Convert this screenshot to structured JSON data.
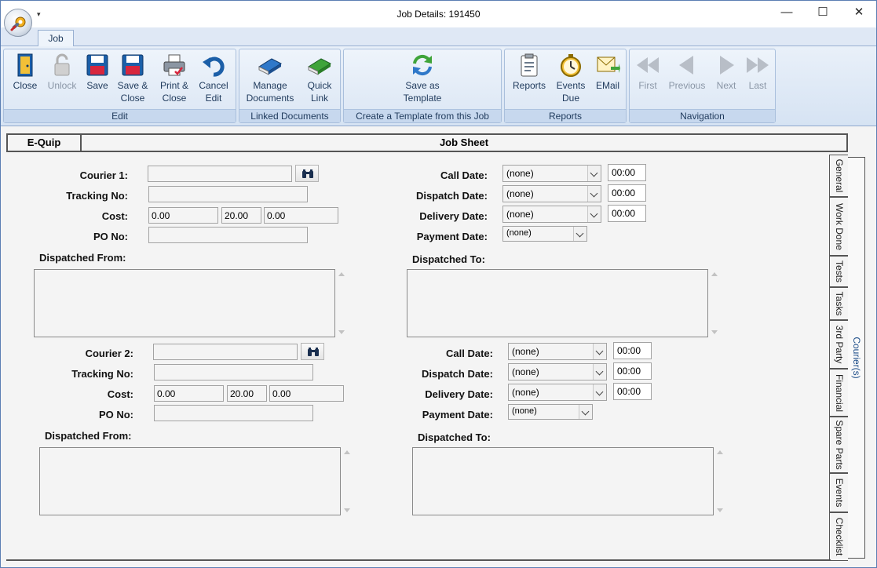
{
  "window": {
    "title": "Job Details: 191450",
    "qat_glyph": "▾",
    "controls": {
      "minimize": "—",
      "maximize": "☐",
      "close": "✕"
    }
  },
  "ribbon": {
    "tab": "Job",
    "groups": {
      "edit": {
        "label": "Edit",
        "buttons": {
          "close": [
            "Close"
          ],
          "unlock": [
            "Unlock"
          ],
          "save": [
            "Save"
          ],
          "save_close": [
            "Save &",
            "Close"
          ],
          "print_close": [
            "Print &",
            "Close"
          ],
          "cancel_edit": [
            "Cancel",
            "Edit"
          ]
        }
      },
      "linked": {
        "label": "Linked Documents",
        "buttons": {
          "manage": [
            "Manage",
            "Documents"
          ],
          "quick_link": [
            "Quick",
            "Link"
          ]
        }
      },
      "template": {
        "label": "Create a Template from this Job",
        "buttons": {
          "save_template": [
            "Save as",
            "Template"
          ]
        }
      },
      "reports": {
        "label": "Reports",
        "buttons": {
          "reports": [
            "Reports"
          ],
          "events_due": [
            "Events",
            "Due"
          ],
          "email": [
            "EMail"
          ]
        }
      },
      "navigation": {
        "label": "Navigation",
        "buttons": {
          "first": [
            "First"
          ],
          "previous": [
            "Previous"
          ],
          "next": [
            "Next"
          ],
          "last": [
            "Last"
          ]
        }
      }
    }
  },
  "header": {
    "left": "E-Quip",
    "title": "Job Sheet"
  },
  "courier1": {
    "labels": {
      "courier": "Courier 1:",
      "tracking": "Tracking No:",
      "cost": "Cost:",
      "po": "PO No:",
      "from": "Dispatched From:",
      "to": "Dispatched To:",
      "call": "Call Date:",
      "dispatch": "Dispatch Date:",
      "delivery": "Delivery Date:",
      "payment": "Payment Date:"
    },
    "courier": "",
    "tracking": "",
    "cost": [
      "0.00",
      "20.00",
      "0.00"
    ],
    "po": "",
    "call_date": "(none)",
    "call_time": "00:00",
    "dispatch_date": "(none)",
    "dispatch_time": "00:00",
    "delivery_date": "(none)",
    "delivery_time": "00:00",
    "payment_date": "(none)"
  },
  "courier2": {
    "labels": {
      "courier": "Courier 2:",
      "tracking": "Tracking No:",
      "cost": "Cost:",
      "po": "PO No:",
      "from": "Dispatched From:",
      "to": "Dispatched To:",
      "call": "Call Date:",
      "dispatch": "Dispatch Date:",
      "delivery": "Delivery Date:",
      "payment": "Payment Date:"
    },
    "courier": "",
    "tracking": "",
    "cost": [
      "0.00",
      "20.00",
      "0.00"
    ],
    "po": "",
    "call_date": "(none)",
    "call_time": "00:00",
    "dispatch_date": "(none)",
    "dispatch_time": "00:00",
    "delivery_date": "(none)",
    "delivery_time": "00:00",
    "payment_date": "(none)"
  },
  "side_tabs": [
    "General",
    "Work Done",
    "Tests",
    "Tasks",
    "3rd Party",
    "Financial",
    "Spare Parts",
    "Events",
    "Checklist"
  ],
  "active_tab": "Courier(s)",
  "colors": {
    "accent": "#1e395b",
    "ribbon": "#dfe8f5"
  }
}
